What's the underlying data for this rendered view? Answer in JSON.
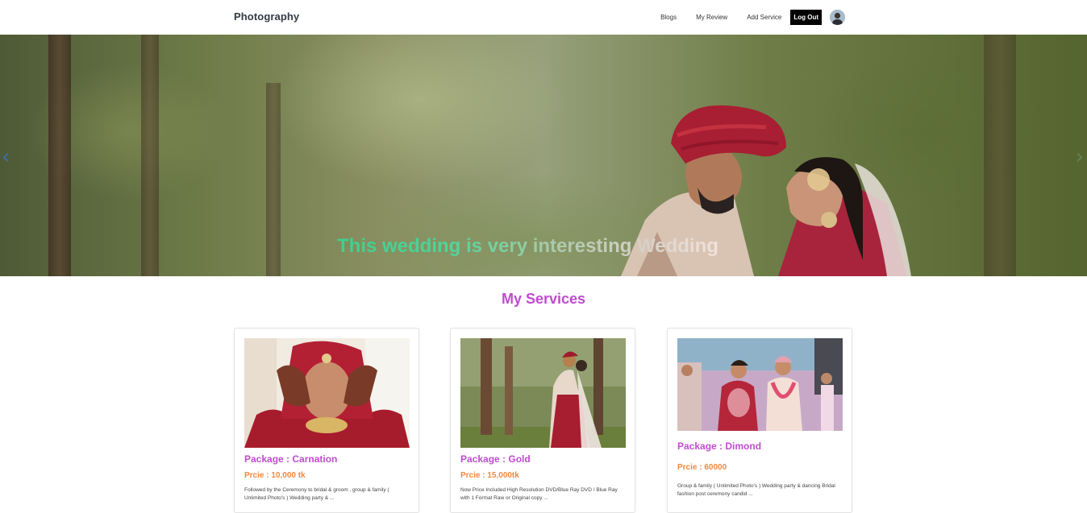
{
  "brand": "Photography",
  "nav": {
    "blogs": "Blogs",
    "my_review": "My Review",
    "add_service": "Add Service",
    "logout": "Log Out"
  },
  "hero": {
    "caption": "This wedding is very interesting Wedding",
    "prev_icon": "chevron-left-icon",
    "next_icon": "chevron-right-icon"
  },
  "services": {
    "title": "My Services",
    "items": [
      {
        "package": "Package : Carnation",
        "price": "Prcie : 10,000 tk",
        "description": "Followed by the Ceremony to bridal & groom , group & family ( Unlimited Photo's ) Wedding party & ..."
      },
      {
        "package": "Package : Gold",
        "price": "Prcie : 15,000tk",
        "description": "Now Price Included High Resolution DVD/Blue Ray DVD / Blue Ray with 1 Format Raw or Original copy ..."
      },
      {
        "package": "Package : Dimond",
        "price": "Prcie : 60000",
        "description": "Group & family ( Unlimited Photo's ) Wedding party & dancing Bridal fashion post ceremony candid ..."
      }
    ]
  },
  "colors": {
    "accent": "#c04bd0",
    "price": "#f0883e",
    "hero_text": "#3fcf8e",
    "logout_bg": "#000000"
  }
}
